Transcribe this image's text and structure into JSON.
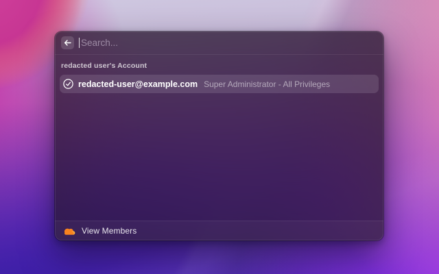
{
  "window": {
    "search": {
      "placeholder": "Search..."
    },
    "account_section": {
      "header": "redacted user's Account",
      "row": {
        "email": "redacted-user@example.com",
        "role": "Super Administrator - All Privileges"
      }
    },
    "footer": {
      "view_members": "View Members"
    }
  },
  "icons": {
    "back": "back-arrow-icon",
    "selected_account": "checkmark-circle-icon",
    "brand": "cloudflare-cloud-icon"
  },
  "colors": {
    "cloudflare_orange": "#F6821F",
    "cloudflare_orange_light": "#FBAD41",
    "selection_highlight": "rgba(255,255,255,0.12)"
  }
}
